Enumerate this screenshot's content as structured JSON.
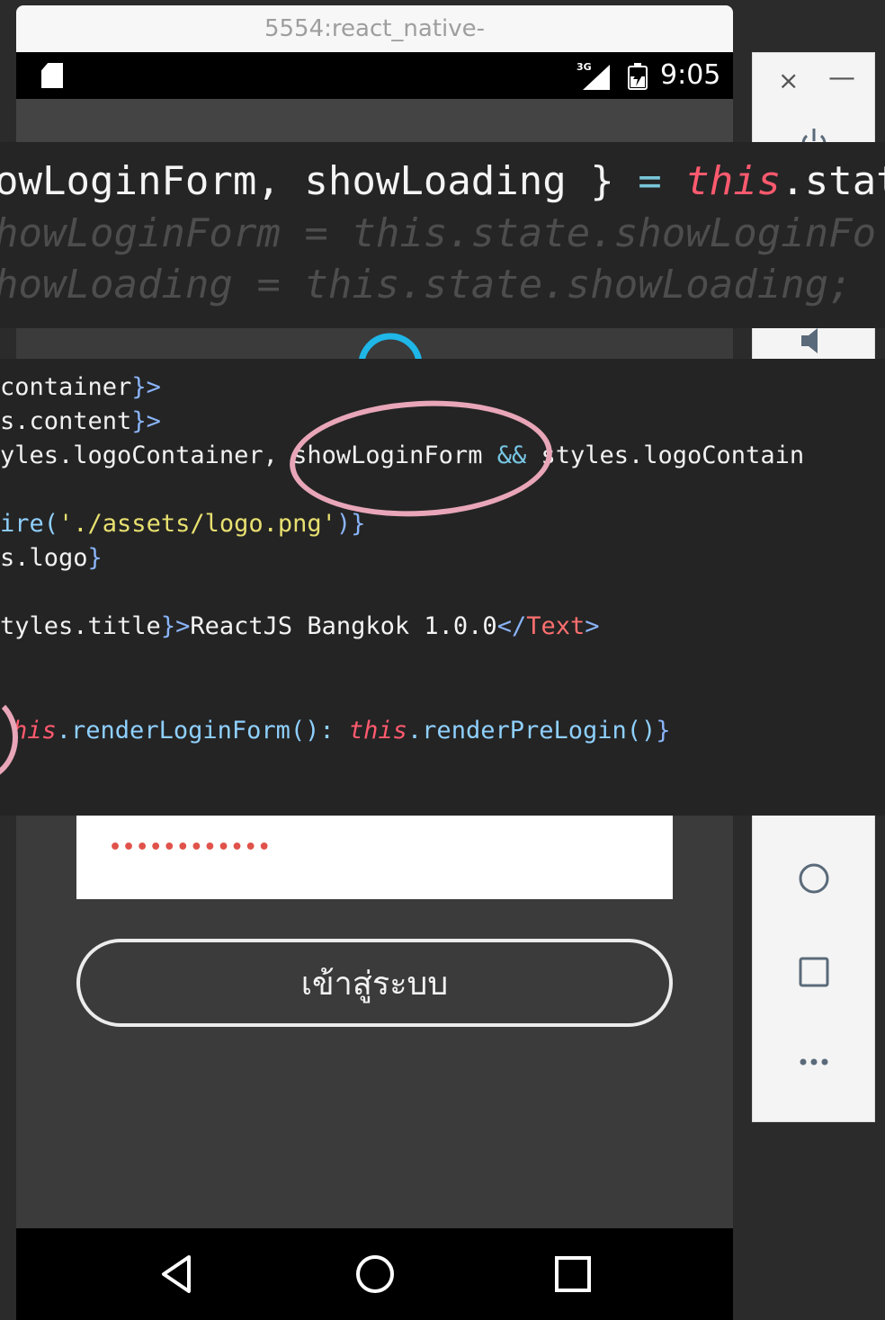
{
  "emulator": {
    "title": "5554:react_native-",
    "status_bar": {
      "network": "3G",
      "time": "9:05"
    },
    "password_field": {
      "value": "••••••••••••"
    },
    "login_button": {
      "label": "เข้าสู่ระบบ"
    },
    "nav": {
      "icons": [
        "back-icon",
        "home-icon",
        "recents-icon"
      ]
    },
    "toolbar": {
      "close": "×",
      "minimize": "—",
      "icons": [
        "power-icon",
        "volume-icon",
        "home-circle-icon",
        "overview-square-icon",
        "more-icon"
      ]
    }
  },
  "code_overlay_top": {
    "line1": {
      "a": "owLoginForm, showLoading } ",
      "eq": "=",
      "sp": " ",
      "this": "this",
      "rest": ".stat"
    },
    "line2": {
      "a": "howLoginForm = this.state.showLoginFo"
    },
    "line3": {
      "a": "howLoading = this.state.showLoading;"
    }
  },
  "code_overlay_main": {
    "lines": [
      {
        "a": "container",
        "b": "}>"
      },
      {
        "a": "s.content",
        "b": "}>"
      },
      {
        "a": "yles.logoContainer",
        "b": ", ",
        "c": "showLoginForm",
        "d": " && ",
        "e": "styles.logoContain"
      },
      {
        "a": "ire(",
        "b": "'./assets/logo.png'",
        "c": ")}"
      },
      {
        "a": "s.logo",
        "b": "}"
      },
      {
        "a": "tyles.title",
        "b": "}>",
        "c": "ReactJS Bangkok 1.0.0",
        "d": "</",
        "e": "Text",
        "f": ">"
      },
      {
        "a": "his",
        "b": ".renderLoginForm(): ",
        "c": "this",
        "d": ".renderPreLogin()",
        "e": "}"
      }
    ]
  },
  "colors": {
    "accent_pink": "#e8a6b8",
    "code_bg": "#242424",
    "keyword_red": "#ff5a6e"
  }
}
